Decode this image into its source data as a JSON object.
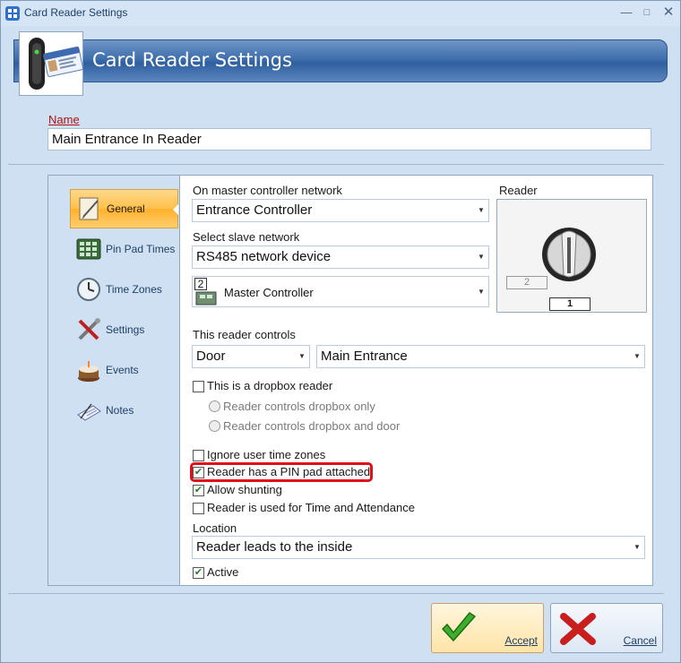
{
  "window": {
    "title": "Card Reader Settings",
    "min_symbol": "—",
    "max_symbol": "□",
    "close_symbol": "✕"
  },
  "header": {
    "title": "Card Reader Settings",
    "icon": "card-reader-icon"
  },
  "name": {
    "label": "Name",
    "value": "Main Entrance In Reader"
  },
  "nav": {
    "items": [
      {
        "label": "General",
        "icon": "general-icon",
        "active": true
      },
      {
        "label": "Pin Pad Times",
        "icon": "pin-pad-icon",
        "active": false
      },
      {
        "label": "Time Zones",
        "icon": "clock-icon",
        "active": false
      },
      {
        "label": "Settings",
        "icon": "tools-icon",
        "active": false
      },
      {
        "label": "Events",
        "icon": "cake-icon",
        "active": false
      },
      {
        "label": "Notes",
        "icon": "notes-icon",
        "active": false
      }
    ]
  },
  "general": {
    "master_network_label": "On master controller network",
    "master_network_value": "Entrance Controller",
    "slave_network_label": "Select slave network",
    "slave_network_value": "RS485 network device",
    "controller_badge": "2",
    "controller_value": "Master Controller",
    "reader_label": "Reader",
    "reader_secondary": "2",
    "reader_primary": "1",
    "controls_label": "This reader controls",
    "controls_type": "Door",
    "controls_target": "Main Entrance",
    "dropbox_label": "This is a dropbox reader",
    "dropbox_only_label": "Reader controls dropbox only",
    "dropbox_door_label": "Reader controls dropbox and door",
    "ignore_tz_label": "Ignore user time zones",
    "pin_pad_label": "Reader has a PIN pad attached",
    "shunting_label": "Allow shunting",
    "time_attendance_label": "Reader is used for Time and Attendance",
    "location_label": "Location",
    "location_value": "Reader leads to the inside",
    "active_label": "Active",
    "checks": {
      "dropbox": false,
      "ignore_tz": false,
      "pin_pad": true,
      "shunting": true,
      "time_attendance": false,
      "active": true
    }
  },
  "buttons": {
    "accept": "Accept",
    "cancel": "Cancel"
  },
  "colors": {
    "accent": "#2f5f9f",
    "highlight": "#e0101a",
    "active_nav": "#ffc04a"
  }
}
